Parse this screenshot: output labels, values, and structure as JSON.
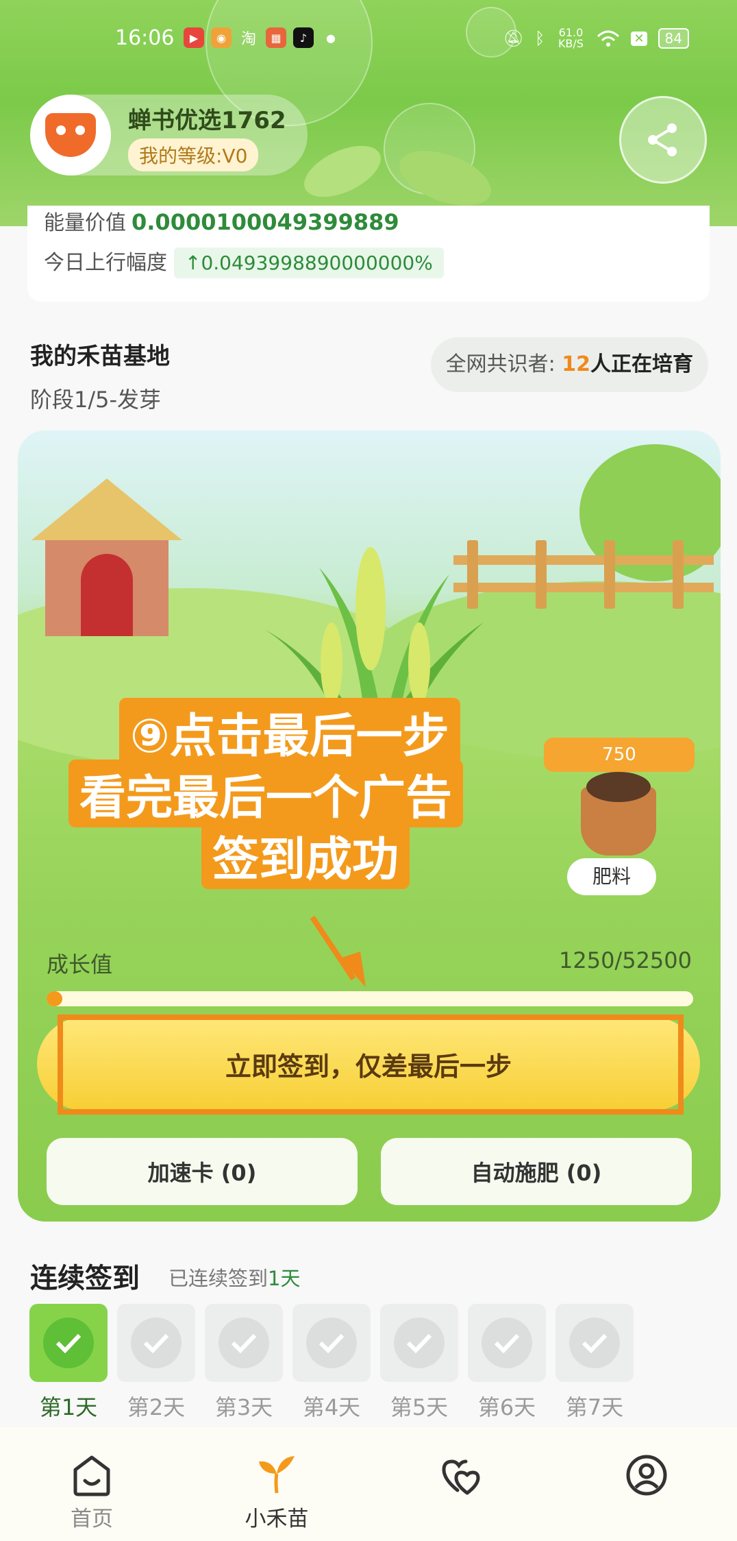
{
  "status_bar": {
    "time": "16:06",
    "network_speed": "61.0 KB/S",
    "battery": "84"
  },
  "profile": {
    "name": "蝉书优选1762",
    "level": "我的等级:V0"
  },
  "stats": {
    "energy_label": "能量价值",
    "energy_value": "0.0000100049399889",
    "rise_label": "今日上行幅度",
    "rise_value": "↑0.0493998890000000%"
  },
  "base": {
    "title": "我的禾苗基地",
    "stage": "阶段1/5-发芽",
    "together_prefix": "全网共识者: ",
    "together_count": "12",
    "together_suffix": "人正在培育"
  },
  "scene": {
    "tip_lines": [
      "⑨点击最后一步",
      "看完最后一个广告",
      "签到成功"
    ],
    "fertilizer_count": "750",
    "fertilizer_label": "肥料",
    "growth_label": "成长值",
    "growth_value": "1250/52500",
    "growth_progress": 0.024,
    "sign_button": "立即签到，仅差最后一步",
    "speed_card": "加速卡 (0)",
    "auto_fertilize": "自动施肥 (0)"
  },
  "checkin": {
    "title": "连续签到",
    "subtitle_prefix": "已连续签到",
    "subtitle_days": "1天",
    "days": [
      "第1天",
      "第2天",
      "第3天",
      "第4天",
      "第5天",
      "第6天",
      "第7天"
    ]
  },
  "tabs": {
    "home": "首页",
    "seedling": "小禾苗"
  },
  "colors": {
    "accent_orange": "#f39a1c",
    "brand_green": "#2e8b3a",
    "button_yellow": "#f7cf35"
  }
}
